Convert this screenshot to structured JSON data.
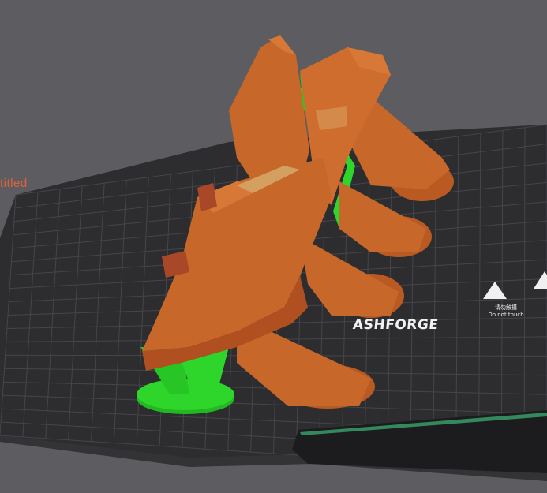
{
  "plate": {
    "name": "titled",
    "brand": "ASHFORGE",
    "warning": {
      "cn": "请勿触摸",
      "en": "Do not touch"
    }
  },
  "colors": {
    "background": "#5c5c61",
    "plate": "#2d2d30",
    "grid": "#46464b",
    "model": "#c8672a",
    "support": "#2ed52a",
    "accent_text": "#e0623a",
    "handle_accent": "#3aa56b"
  },
  "icons": {
    "warning": "hand-warning-icon"
  }
}
